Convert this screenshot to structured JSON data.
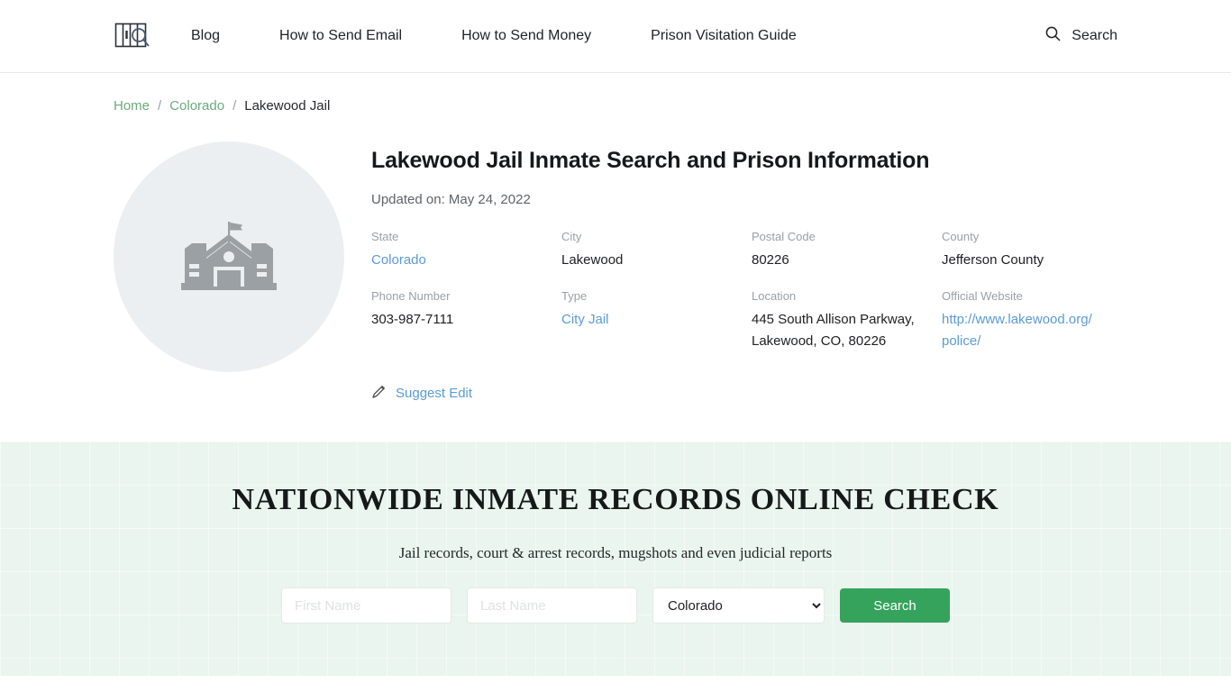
{
  "header": {
    "logo_icon": "jail-bars-magnifier-logo",
    "nav": [
      {
        "label": "Blog"
      },
      {
        "label": "How to Send Email"
      },
      {
        "label": "How to Send Money"
      },
      {
        "label": "Prison Visitation Guide"
      }
    ],
    "search": {
      "icon": "search-icon",
      "label": "Search"
    }
  },
  "breadcrumb": {
    "home": "Home",
    "state": "Colorado",
    "current": "Lakewood Jail",
    "separator": "/"
  },
  "profile": {
    "avatar_icon": "school-building-icon",
    "title": "Lakewood Jail Inmate Search and Prison Information",
    "updated": "Updated on: May 24, 2022",
    "fields": [
      {
        "label": "State",
        "value": "Colorado",
        "kind": "link"
      },
      {
        "label": "City",
        "value": "Lakewood",
        "kind": "text"
      },
      {
        "label": "Postal Code",
        "value": "80226",
        "kind": "text"
      },
      {
        "label": "County",
        "value": "Jefferson County",
        "kind": "text"
      },
      {
        "label": "Phone Number",
        "value": "303-987-7111",
        "kind": "text"
      },
      {
        "label": "Type",
        "value": "City Jail",
        "kind": "link"
      },
      {
        "label": "Location",
        "value": "445 South Allison Parkway, Lakewood, CO, 80226",
        "kind": "text"
      },
      {
        "label": "Official Website",
        "value": "http://www.lakewood.org/police/",
        "kind": "url"
      }
    ],
    "suggest_edit": {
      "icon": "pencil-icon",
      "label": "Suggest Edit"
    }
  },
  "promo": {
    "title": "NATIONWIDE INMATE RECORDS ONLINE CHECK",
    "subtitle": "Jail records, court & arrest records, mugshots and even judicial reports",
    "first_name_placeholder": "First Name",
    "first_name_value": "",
    "last_name_placeholder": "Last Name",
    "last_name_value": "",
    "state_selected": "Colorado",
    "state_options": [
      "Colorado"
    ],
    "search_button": "Search"
  },
  "colors": {
    "brand_green": "#35a35c",
    "breadcrumb_link": "#6aab7e",
    "link_blue": "#5b9bd5",
    "promo_bg": "#e9f5ee",
    "avatar_bg": "#eceff1"
  }
}
